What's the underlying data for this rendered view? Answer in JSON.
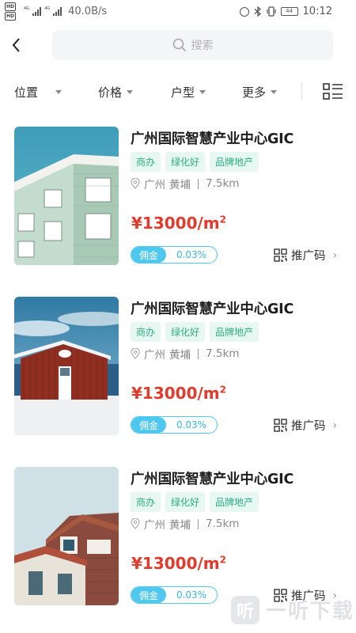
{
  "status_bar": {
    "network_speed": "40.0B/s",
    "battery_level": "44",
    "time": "10:12",
    "hd_labels": [
      "HD",
      "HD"
    ],
    "network_type": "4G"
  },
  "header": {
    "search_placeholder": "搜索"
  },
  "filters": {
    "location": "位置",
    "price": "价格",
    "layout": "户型",
    "more": "更多"
  },
  "listings": [
    {
      "title": "广州国际智慧产业中心GIC",
      "tags": [
        "商办",
        "绿化好",
        "品牌地产"
      ],
      "city": "广州",
      "district": "黄埔",
      "distance": "7.5km",
      "price": "¥13000/m",
      "price_unit_sup": "2",
      "commission_label": "佣金",
      "commission": "0.03%",
      "promo_label": "推广码",
      "chevron": "›"
    },
    {
      "title": "广州国际智慧产业中心GIC",
      "tags": [
        "商办",
        "绿化好",
        "品牌地产"
      ],
      "city": "广州",
      "district": "黄埔",
      "distance": "7.5km",
      "price": "¥13000/m",
      "price_unit_sup": "2",
      "commission_label": "佣金",
      "commission": "0.03%",
      "promo_label": "推广码",
      "chevron": "›"
    },
    {
      "title": "广州国际智慧产业中心GIC",
      "tags": [
        "商办",
        "绿化好",
        "品牌地产"
      ],
      "city": "广州",
      "district": "黄埔",
      "distance": "7.5km",
      "price": "¥13000/m",
      "price_unit_sup": "2",
      "commission_label": "佣金",
      "commission": "0.03%",
      "promo_label": "推广码",
      "chevron": "›"
    }
  ],
  "watermark": {
    "logo_char": "听",
    "text": "一听下载"
  },
  "colors": {
    "price": "#e03b2d",
    "tag_text": "#2bae83",
    "tag_bg": "#e7f7f1",
    "commission": "#4fc8f0"
  }
}
